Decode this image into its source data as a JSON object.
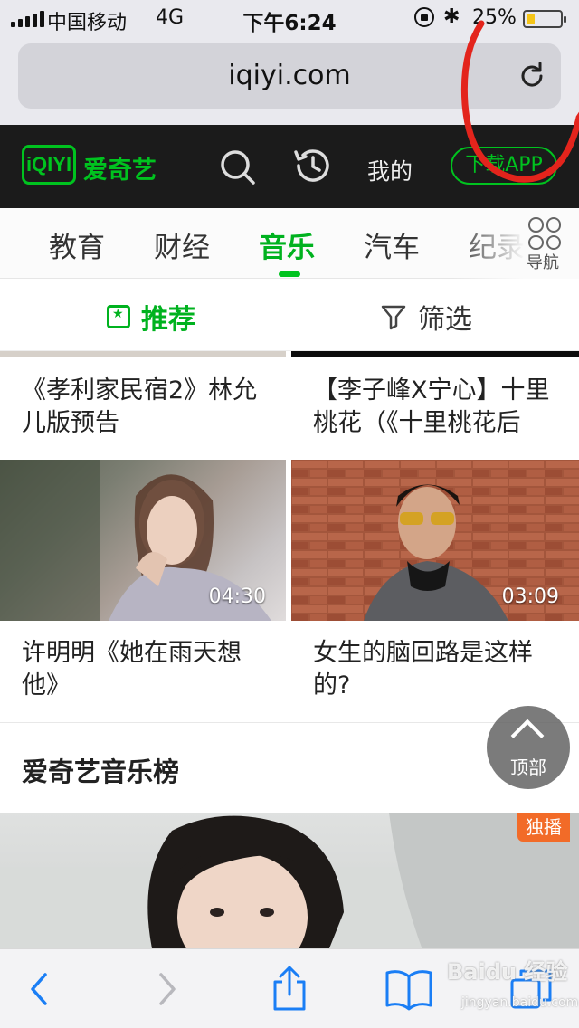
{
  "status_bar": {
    "carrier": "中国移动",
    "network": "4G",
    "time": "下午6:24",
    "battery_text": "25%",
    "battery_level": 0.25,
    "battery_color": "#f5c518"
  },
  "browser": {
    "url": "iqiyi.com"
  },
  "site_header": {
    "logo_mark": "iQIYI",
    "logo_text": "爱奇艺",
    "mine_label": "我的",
    "download_label": "下载APP",
    "brand_color": "#00c31f"
  },
  "categories": {
    "tabs": [
      "ı",
      "教育",
      "财经",
      "音乐",
      "汽车",
      "纪录"
    ],
    "active": "音乐",
    "nav_label": "导航"
  },
  "filter": {
    "recommend_label": "推荐",
    "screen_label": "筛选"
  },
  "videos": [
    {
      "title_line1": "《孝利家民宿2》林允",
      "title_line2": "儿版预告"
    },
    {
      "title_line1": "【李子峰X宁心】十里",
      "title_line2": "桃花（《十里桃花后"
    },
    {
      "title_line1": "许明明《她在雨天想",
      "title_line2": "他》",
      "duration": "04:30"
    },
    {
      "title_line1": "女生的脑回路是这样",
      "title_line2": "的?",
      "duration": "03:09"
    }
  ],
  "music_chart": {
    "title": "爱奇艺音乐榜",
    "badge": "独播"
  },
  "back_to_top": {
    "label": "顶部"
  },
  "toolbar": {
    "icons": [
      "back-icon",
      "forward-icon",
      "share-icon",
      "bookmarks-icon",
      "tabs-icon"
    ]
  },
  "watermark": {
    "text": "Baidu 经验",
    "sub": "jingyan.baidu.com"
  }
}
